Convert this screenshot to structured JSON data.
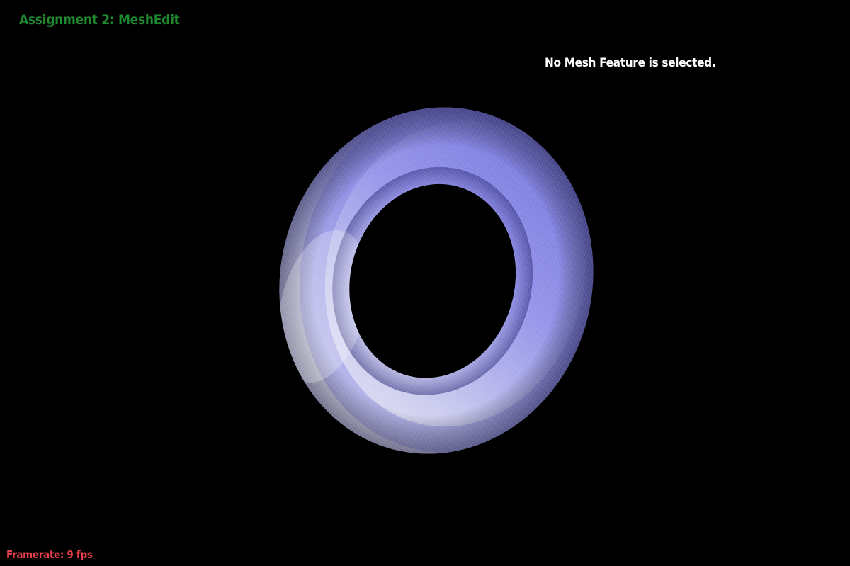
{
  "app": {
    "title": "Assignment 2: MeshEdit",
    "title_color": "#1e8a2e"
  },
  "overlay": {
    "selection_status": "No Mesh Feature is selected.",
    "selection_color": "#ffffff"
  },
  "stats": {
    "framerate_label": "Framerate: 9 fps",
    "framerate_color": "#e8404a"
  },
  "scene": {
    "background_color": "#000000",
    "mesh": {
      "shape": "torus",
      "surface_color": "#8c8cf0",
      "wireframe_color": "#e8e8f0",
      "wireframe_visible": true
    }
  }
}
